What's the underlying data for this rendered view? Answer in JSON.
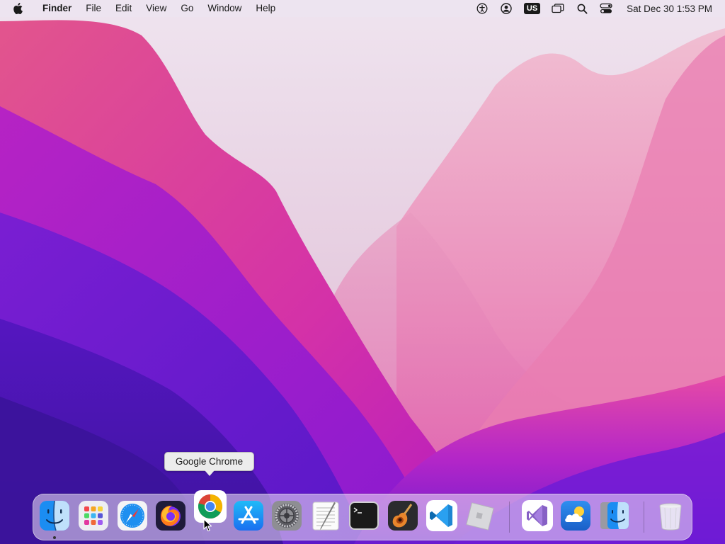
{
  "menubar": {
    "apple_icon": "apple-icon",
    "app_name": "Finder",
    "menus": [
      "File",
      "Edit",
      "View",
      "Go",
      "Window",
      "Help"
    ],
    "status_icons": [
      "accessibility-icon",
      "user-account-icon",
      "input-source-icon",
      "screen-mirroring-icon",
      "spotlight-search-icon",
      "control-center-icon"
    ],
    "input_source": "US",
    "clock": "Sat Dec 30  1:53 PM"
  },
  "tooltip": {
    "text": "Google Chrome"
  },
  "dock": {
    "apps": [
      {
        "name": "finder",
        "icon": "finder-icon",
        "running": true
      },
      {
        "name": "launchpad",
        "icon": "launchpad-icon",
        "running": false
      },
      {
        "name": "safari",
        "icon": "safari-icon",
        "running": false
      },
      {
        "name": "firefox",
        "icon": "firefox-icon",
        "running": false
      },
      {
        "name": "google-chrome",
        "icon": "chrome-icon",
        "running": false,
        "hovered": true
      },
      {
        "name": "app-store",
        "icon": "app-store-icon",
        "running": false
      },
      {
        "name": "system-preferences",
        "icon": "system-preferences-icon",
        "running": false
      },
      {
        "name": "textedit",
        "icon": "textedit-icon",
        "running": false
      },
      {
        "name": "terminal",
        "icon": "terminal-icon",
        "running": false
      },
      {
        "name": "garageband",
        "icon": "garageband-icon",
        "running": false
      },
      {
        "name": "visual-studio-code",
        "icon": "vscode-icon",
        "running": false
      },
      {
        "name": "roblox",
        "icon": "roblox-icon",
        "running": false
      }
    ],
    "recent_apps": [
      {
        "name": "visual-studio",
        "icon": "visual-studio-icon"
      },
      {
        "name": "weather",
        "icon": "weather-icon"
      },
      {
        "name": "migration-assistant",
        "icon": "migration-assistant-icon"
      }
    ],
    "trash": {
      "name": "trash",
      "icon": "trash-icon"
    }
  },
  "colors": {
    "wallpaper_top": "#e8d9ee",
    "wallpaper_pink": "#d93aa8",
    "wallpaper_purple": "#4a1fb0",
    "menubar_bg": "#ece4f0",
    "dock_bg": "#f0e8f6"
  }
}
